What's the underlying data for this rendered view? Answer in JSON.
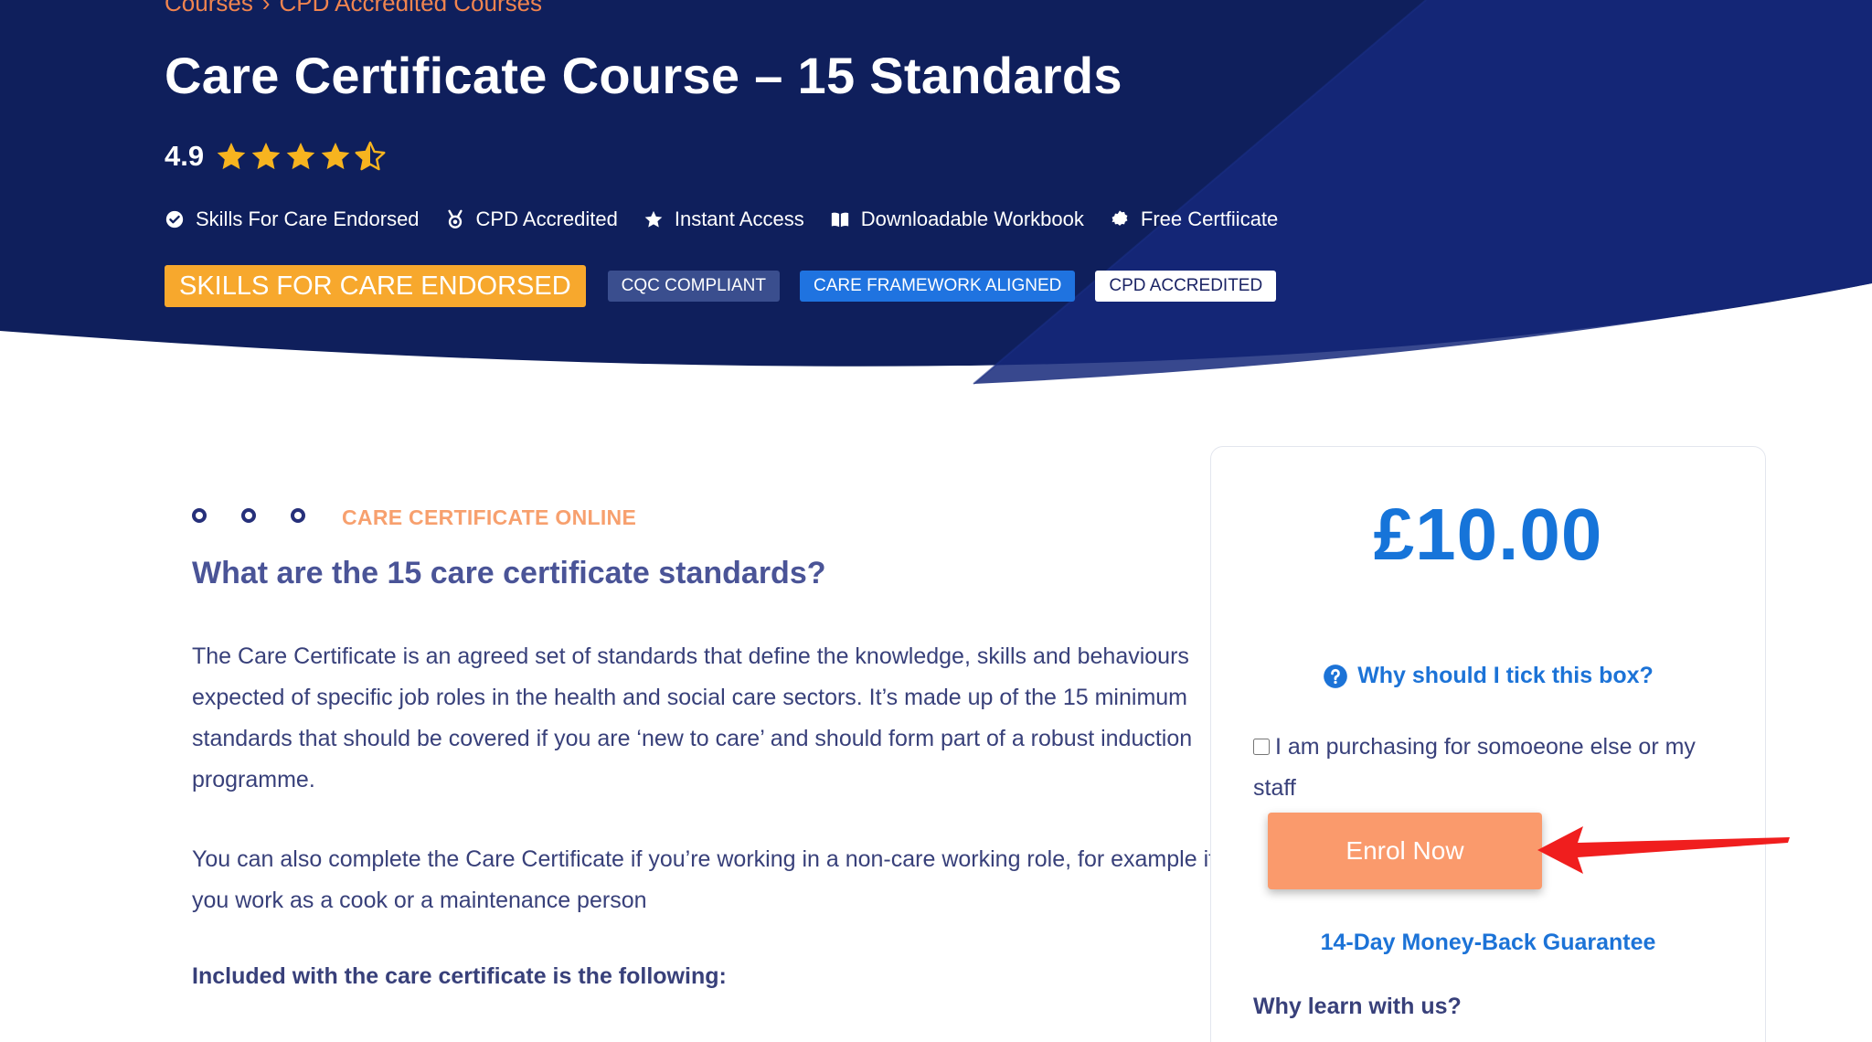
{
  "colors": {
    "hero_bg": "#0f1f5c",
    "hero_accent": "#15287a",
    "orange_accent": "#f7a82d",
    "price_blue": "#1674d9",
    "enrol_orange": "#fa9a6c",
    "annotation_red": "#f01e1e"
  },
  "breadcrumb": [
    "Courses",
    "CPD Accredited Courses"
  ],
  "breadcrumb_separator": "›",
  "course": {
    "title": "Care Certificate Course – 15 Standards",
    "rating": "4.9",
    "rating_stars": 4.5
  },
  "features": [
    {
      "icon": "check-circle-icon",
      "label": "Skills For Care Endorsed"
    },
    {
      "icon": "medal-icon",
      "label": "CPD Accredited"
    },
    {
      "icon": "star-icon",
      "label": "Instant Access"
    },
    {
      "icon": "book-open-icon",
      "label": "Downloadable Workbook"
    },
    {
      "icon": "badge-certificate-icon",
      "label": "Free Certfiicate"
    }
  ],
  "badges": [
    {
      "label": "SKILLS FOR CARE ENDORSED",
      "color": "#f7a82d"
    },
    {
      "label": "CQC COMPLIANT",
      "color": "#3a4e8e"
    },
    {
      "label": "CARE FRAMEWORK ALIGNED",
      "color": "#1f73e0"
    },
    {
      "label": "CPD ACCREDITED",
      "color": "#ffffff"
    }
  ],
  "content": {
    "eyebrow": "CARE CERTIFICATE ONLINE",
    "heading": "What are the 15 care certificate standards?",
    "paragraph1": "The Care Certificate is an agreed set of standards that define the knowledge, skills and behaviours expected of specific job roles in the health and social care sectors. It’s made up of the 15 minimum standards that should be covered if you are ‘new to care’ and should form part of a robust induction programme.",
    "paragraph2": "You can also complete the Care Certificate if you’re working in a non-care working role, for example if you work as a cook or a maintenance person",
    "included_heading": "Included with the care certificate is the following:"
  },
  "card": {
    "price": "£10.00",
    "why_tick": "Why should I tick this box?",
    "purchase_label": "I am purchasing for somoeone else or my staff",
    "purchase_checked": false,
    "enrol_label": "Enrol Now",
    "guarantee": "14-Day Money-Back Guarantee",
    "why_learn": "Why learn with us?"
  }
}
